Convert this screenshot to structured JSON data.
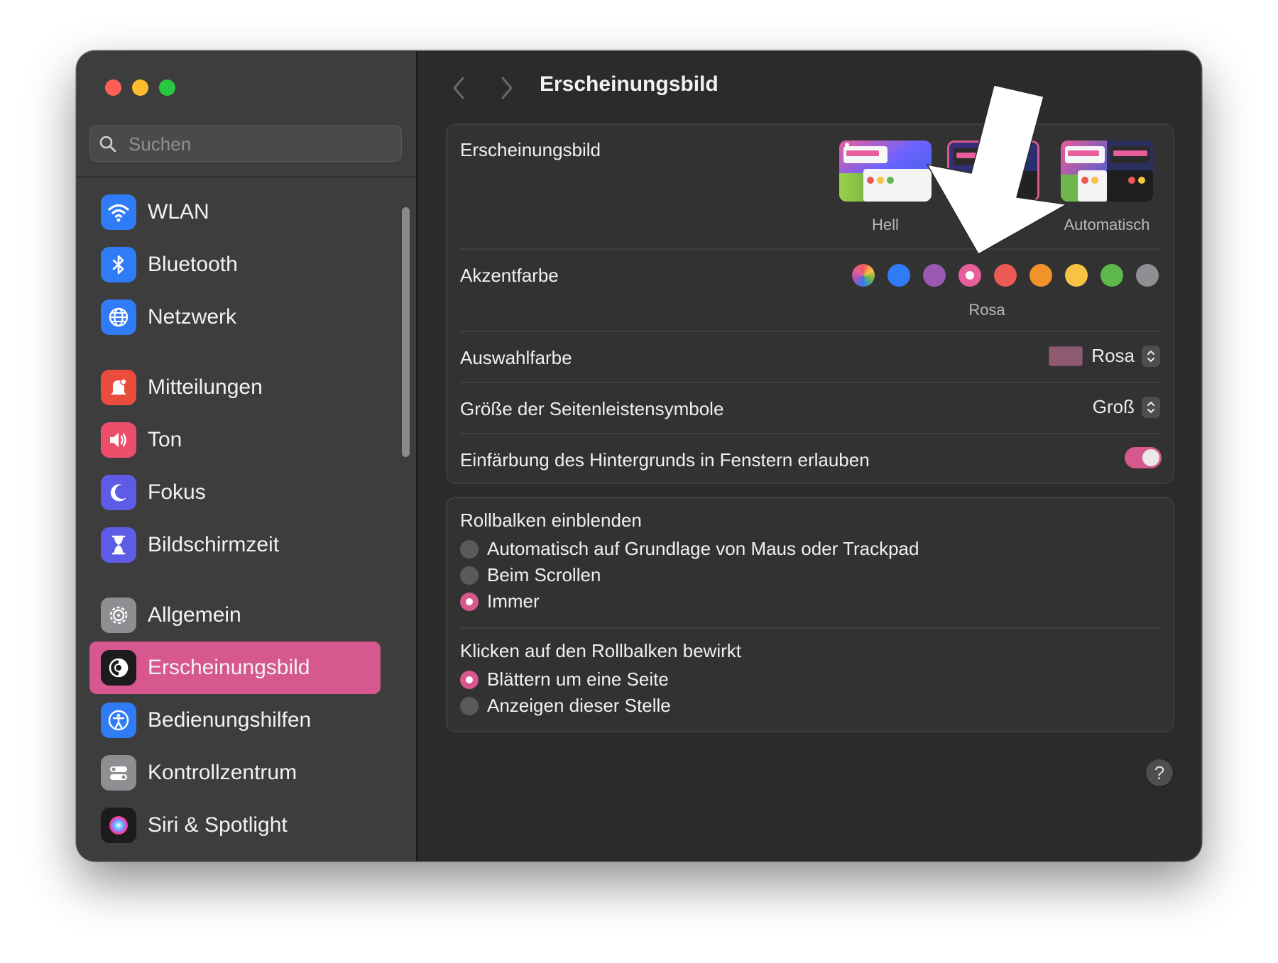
{
  "window": {
    "traffic_lights": [
      "close",
      "minimize",
      "zoom"
    ]
  },
  "sidebar": {
    "search_placeholder": "Suchen",
    "groups": [
      [
        {
          "label": "WLAN",
          "icon": "wifi-icon",
          "color": "#2f7cf6"
        },
        {
          "label": "Bluetooth",
          "icon": "bluetooth-icon",
          "color": "#2f7cf6"
        },
        {
          "label": "Netzwerk",
          "icon": "globe-icon",
          "color": "#2f7cf6"
        }
      ],
      [
        {
          "label": "Mitteilungen",
          "icon": "bell-icon",
          "color": "#eb4d3d"
        },
        {
          "label": "Ton",
          "icon": "speaker-icon",
          "color": "#eb4d6a"
        },
        {
          "label": "Fokus",
          "icon": "moon-icon",
          "color": "#5e5ce6"
        },
        {
          "label": "Bildschirmzeit",
          "icon": "hourglass-icon",
          "color": "#5e5ce6"
        }
      ],
      [
        {
          "label": "Allgemein",
          "icon": "gear-icon",
          "color": "#8e8e93"
        },
        {
          "label": "Erscheinungsbild",
          "icon": "appearance-icon",
          "color": "#1c1c1e",
          "selected": true
        },
        {
          "label": "Bedienungshilfen",
          "icon": "accessibility-icon",
          "color": "#2f7cf6"
        },
        {
          "label": "Kontrollzentrum",
          "icon": "control-center-icon",
          "color": "#8e8e93"
        },
        {
          "label": "Siri & Spotlight",
          "icon": "siri-icon",
          "color": "#1c1c1e"
        }
      ]
    ]
  },
  "content": {
    "title": "Erscheinungsbild",
    "appearance": {
      "label": "Erscheinungsbild",
      "options": [
        "Hell",
        "",
        "Automatisch"
      ]
    },
    "accent": {
      "label": "Akzentfarbe",
      "colors": [
        "multicolor",
        "#2f7cf6",
        "#9b59b6",
        "#e85d9b",
        "#ec5a55",
        "#f0932b",
        "#f6c343",
        "#5fb84c",
        "#8e8e93"
      ],
      "selected_index": 3,
      "selected_name": "Rosa"
    },
    "highlight": {
      "label": "Auswahlfarbe",
      "value": "Rosa",
      "swatch": "#8e5a72"
    },
    "sidebar_icon_size": {
      "label": "Größe der Seitenleistensymbole",
      "value": "Groß"
    },
    "wallpaper_tinting": {
      "label": "Einfärbung des Hintergrunds in Fenstern erlauben",
      "enabled": true
    },
    "show_scroll_bars": {
      "label": "Rollbalken einblenden",
      "options": [
        "Automatisch auf Grundlage von Maus oder Trackpad",
        "Beim Scrollen",
        "Immer"
      ],
      "selected_index": 2
    },
    "click_scroll_bar": {
      "label": "Klicken auf den Rollbalken bewirkt",
      "options": [
        "Blättern um eine Seite",
        "Anzeigen dieser Stelle"
      ],
      "selected_index": 0
    },
    "help_label": "?"
  },
  "colors": {
    "accent": "#d6588e"
  }
}
